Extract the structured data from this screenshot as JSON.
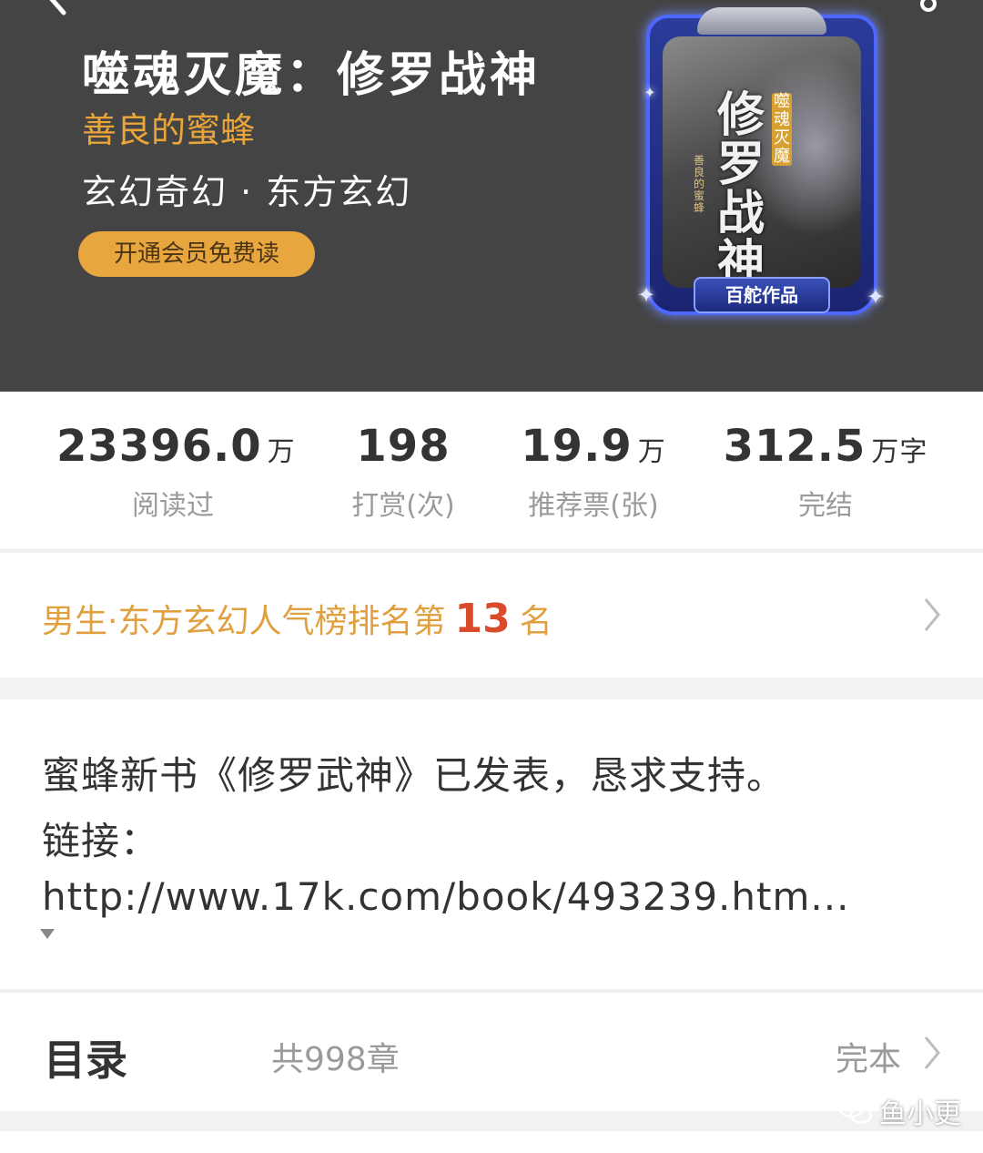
{
  "book": {
    "title": "噬魂灭魔：修罗战神",
    "author": "善良的蜜蜂",
    "genre": "玄幻奇幻 · 东方玄幻",
    "vip_label": "开通会员免费读",
    "cover": {
      "title": "修罗战神",
      "subtitle": "噬魂灭魔",
      "author": "善良的蜜蜂",
      "badge": "百舵作品"
    }
  },
  "stats": [
    {
      "value": "23396.0",
      "unit": "万",
      "label": "阅读过"
    },
    {
      "value": "198",
      "unit": "",
      "label": "打赏(次)"
    },
    {
      "value": "19.9",
      "unit": "万",
      "label": "推荐票(张)"
    },
    {
      "value": "312.5",
      "unit": "万字",
      "label": "完结"
    }
  ],
  "ranking": {
    "prefix": "男生·东方玄幻人气榜排名第",
    "rank": "13",
    "suffix": "名"
  },
  "intro": {
    "line1": "蜜蜂新书《修罗武神》已发表，恳求支持。",
    "line2": "链接：",
    "line3": "http://www.17k.com/book/493239.htm..."
  },
  "toc": {
    "title": "目录",
    "count": "共998章",
    "status": "完本"
  },
  "watermark": {
    "text": "鱼小更"
  },
  "colors": {
    "header_bg": "#444444",
    "accent": "#e8a63e",
    "rank_number": "#d94b2b"
  }
}
